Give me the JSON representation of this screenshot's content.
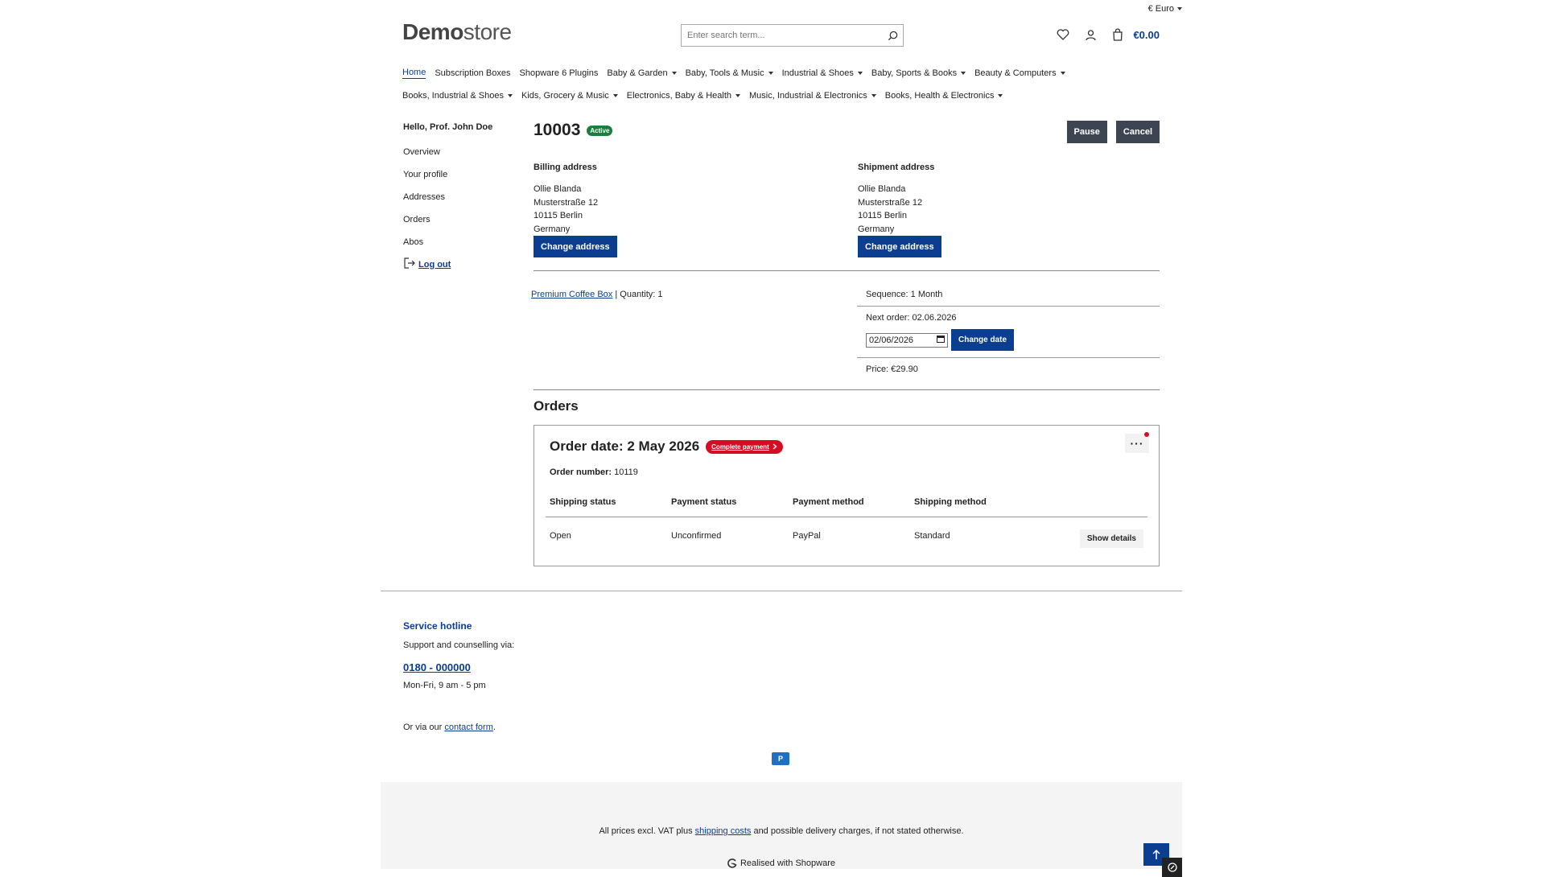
{
  "header": {
    "currency": "€ Euro",
    "logo_bold": "Demo",
    "logo_light": "store",
    "search_placeholder": "Enter search term...",
    "cart_total": "€0.00"
  },
  "nav": {
    "row1": [
      {
        "label": "Home",
        "dropdown": false,
        "active": true
      },
      {
        "label": "Subscription Boxes",
        "dropdown": false
      },
      {
        "label": "Shopware 6 Plugins",
        "dropdown": false
      },
      {
        "label": "Baby & Garden",
        "dropdown": true
      },
      {
        "label": "Baby, Tools & Music",
        "dropdown": true
      },
      {
        "label": "Industrial & Shoes",
        "dropdown": true
      },
      {
        "label": "Baby, Sports & Books",
        "dropdown": true
      },
      {
        "label": "Beauty & Computers",
        "dropdown": true
      }
    ],
    "row2": [
      {
        "label": "Books, Industrial & Shoes",
        "dropdown": true
      },
      {
        "label": "Kids, Grocery & Music",
        "dropdown": true
      },
      {
        "label": "Electronics, Baby & Health",
        "dropdown": true
      },
      {
        "label": "Music, Industrial & Electronics",
        "dropdown": true
      },
      {
        "label": "Books, Health & Electronics",
        "dropdown": true
      }
    ]
  },
  "sidebar": {
    "greeting": "Hello, Prof. John Doe",
    "items": [
      "Overview",
      "Your profile",
      "Addresses",
      "Orders",
      "Abos"
    ],
    "logout": "Log out"
  },
  "subscription": {
    "number": "10003",
    "status": "Active",
    "pause_label": "Pause",
    "cancel_label": "Cancel",
    "billing": {
      "title": "Billing address",
      "lines": [
        "Ollie Blanda",
        "Musterstraße 12",
        "10115 Berlin",
        "Germany"
      ],
      "button": "Change address"
    },
    "shipping": {
      "title": "Shipment address",
      "lines": [
        "Ollie Blanda",
        "Musterstraße 12",
        "10115 Berlin",
        "Germany"
      ],
      "button": "Change address"
    },
    "product_name": "Premium Coffee Box",
    "quantity": "Quantity: 1",
    "sequence": "Sequence: 1 Month",
    "next_order": "Next order: 02.06.2026",
    "date_value": "02/06/2026",
    "change_date_label": "Change date",
    "price": "Price: €29.90"
  },
  "orders": {
    "heading": "Orders",
    "order_date": "Order date: 2 May 2026",
    "complete_payment": "Complete payment",
    "order_number_label": "Order number:",
    "order_number": "10119",
    "columns": [
      "Shipping status",
      "Payment status",
      "Payment method",
      "Shipping method"
    ],
    "values": [
      "Open",
      "Unconfirmed",
      "PayPal",
      "Standard"
    ],
    "show_details": "Show details",
    "more_label": "···"
  },
  "footer": {
    "service_title": "Service hotline",
    "support_text": "Support and counselling via:",
    "phone": "0180 - 000000",
    "hours": "Mon-Fri, 9 am - 5 pm",
    "via_prefix": "Or via our ",
    "contact_link": "contact form",
    "via_suffix": ".",
    "paypal_badge": "P",
    "vat_prefix": "All prices excl. VAT plus ",
    "shipping_link": "shipping costs",
    "vat_suffix": " and possible delivery charges, if not stated otherwise.",
    "realised": "Realised with Shopware"
  },
  "colors": {
    "brand_blue": "#0b3d91",
    "active_green": "#1a7f3c",
    "alert_red": "#d40d22",
    "dark_button": "#3d4452"
  }
}
